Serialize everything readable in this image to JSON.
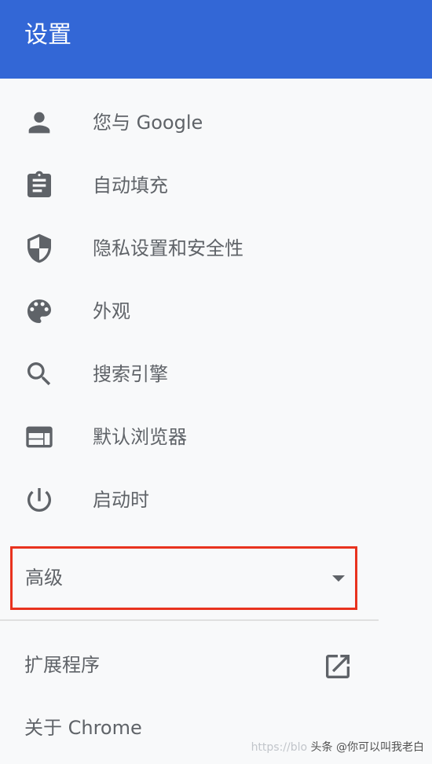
{
  "header": {
    "title": "设置",
    "color": "#3367d6"
  },
  "menu": {
    "items": [
      {
        "label": "您与 Google",
        "icon": "person-icon"
      },
      {
        "label": "自动填充",
        "icon": "clipboard-icon"
      },
      {
        "label": "隐私设置和安全性",
        "icon": "shield-icon"
      },
      {
        "label": "外观",
        "icon": "palette-icon"
      },
      {
        "label": "搜索引擎",
        "icon": "search-icon"
      },
      {
        "label": "默认浏览器",
        "icon": "browser-window-icon"
      },
      {
        "label": "启动时",
        "icon": "power-icon"
      }
    ]
  },
  "advanced": {
    "label": "高级",
    "highlight_color": "#e8321e",
    "icon": "triangle-down-icon"
  },
  "bottom": {
    "extensions": {
      "label": "扩展程序",
      "icon": "open-in-new-icon"
    },
    "about": {
      "label": "关于 Chrome"
    }
  },
  "watermark": {
    "prefix": "https://blo",
    "text": "头条 @你可以叫我老白"
  }
}
